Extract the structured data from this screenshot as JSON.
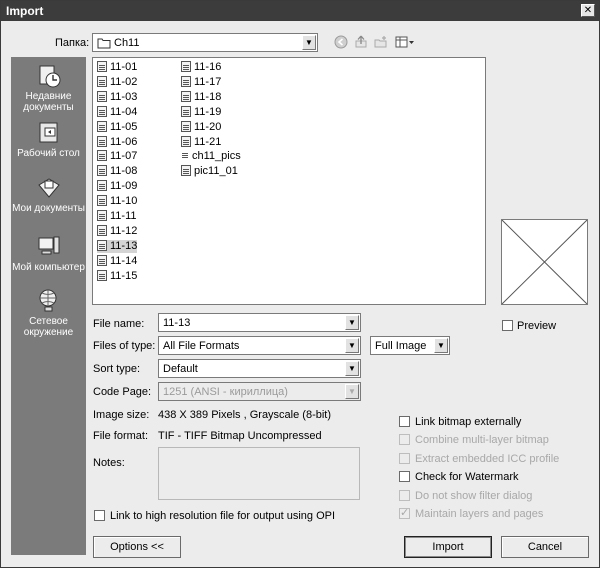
{
  "window": {
    "title": "Import"
  },
  "lookin": {
    "label": "Папка:",
    "value": "Ch11"
  },
  "places": [
    {
      "name": "recent",
      "label": "Недавние документы"
    },
    {
      "name": "desktop",
      "label": "Рабочий стол"
    },
    {
      "name": "mydocs",
      "label": "Мои документы"
    },
    {
      "name": "mycomputer",
      "label": "Мой компьютер"
    },
    {
      "name": "network",
      "label": "Сетевое окружение"
    }
  ],
  "files_col1": [
    "11-01",
    "11-02",
    "11-03",
    "11-04",
    "11-05",
    "11-06",
    "11-07",
    "11-08",
    "11-09",
    "11-10",
    "11-11",
    "11-12",
    "11-13",
    "11-14",
    "11-15"
  ],
  "files_col2": [
    "11-16",
    "11-17",
    "11-18",
    "11-19",
    "11-20",
    "11-21",
    "ch11_pics",
    "pic11_01"
  ],
  "selected_file": "11-13",
  "form": {
    "file_name_label": "File name:",
    "file_name_value": "11-13",
    "files_of_type_label": "Files of type:",
    "files_of_type_value": "All File Formats",
    "image_mode_value": "Full Image",
    "sort_type_label": "Sort type:",
    "sort_type_value": "Default",
    "code_page_label": "Code Page:",
    "code_page_value": "1251  (ANSI - кириллица)",
    "image_size_label": "Image size:",
    "image_size_value": "438 X 389 Pixels , Grayscale (8-bit)",
    "file_format_label": "File format:",
    "file_format_value": "TIF - TIFF Bitmap Uncompressed",
    "notes_label": "Notes:"
  },
  "preview_label": "Preview",
  "options": [
    {
      "label": "Link bitmap externally",
      "checked": false,
      "enabled": true
    },
    {
      "label": "Combine multi-layer bitmap",
      "checked": false,
      "enabled": false
    },
    {
      "label": "Extract embedded ICC profile",
      "checked": false,
      "enabled": false
    },
    {
      "label": "Check for Watermark",
      "checked": false,
      "enabled": true
    },
    {
      "label": "Do not show filter dialog",
      "checked": false,
      "enabled": false
    },
    {
      "label": "Maintain layers and pages",
      "checked": true,
      "enabled": false
    }
  ],
  "opi_label": "Link to high resolution file for output using OPI",
  "buttons": {
    "options": "Options <<",
    "import": "Import",
    "cancel": "Cancel"
  },
  "icons": {
    "close": "close-icon",
    "back": "back-icon",
    "up": "up-folder-icon",
    "new_folder": "new-folder-icon",
    "views": "views-menu-icon"
  }
}
